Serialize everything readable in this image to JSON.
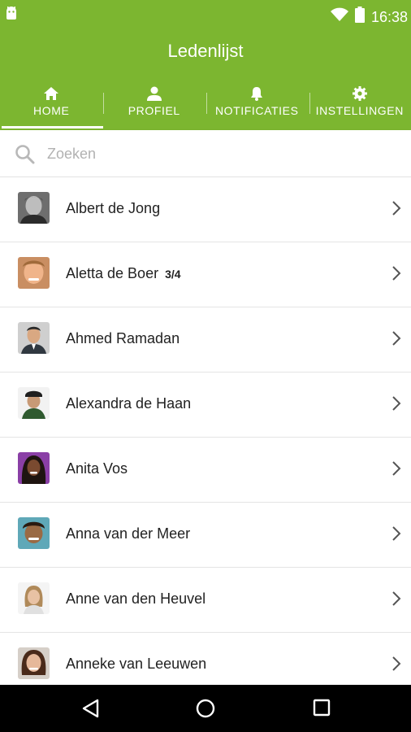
{
  "status_bar": {
    "time": "16:38",
    "icons": [
      "android-icon",
      "wifi-icon",
      "battery-icon"
    ]
  },
  "app_bar": {
    "title": "Ledenlijst",
    "background": "#7cb630"
  },
  "tabs": [
    {
      "label": "HOME",
      "icon": "home-icon",
      "active": true
    },
    {
      "label": "PROFIEL",
      "icon": "person-icon",
      "active": false
    },
    {
      "label": "NOTIFICATIES",
      "icon": "bell-icon",
      "active": false
    },
    {
      "label": "INSTELLINGEN",
      "icon": "gear-icon",
      "active": false
    }
  ],
  "search": {
    "placeholder": "Zoeken",
    "value": ""
  },
  "members": [
    {
      "name": "Albert de Jong",
      "badge": ""
    },
    {
      "name": "Aletta de Boer",
      "badge": "3/4"
    },
    {
      "name": "Ahmed Ramadan",
      "badge": ""
    },
    {
      "name": "Alexandra de Haan",
      "badge": ""
    },
    {
      "name": "Anita Vos",
      "badge": ""
    },
    {
      "name": "Anna van der Meer",
      "badge": ""
    },
    {
      "name": "Anne van den Heuvel",
      "badge": ""
    },
    {
      "name": "Anneke van Leeuwen",
      "badge": ""
    }
  ],
  "nav_bar": {
    "buttons": [
      "back-icon",
      "home-circle-icon",
      "recents-icon"
    ]
  }
}
